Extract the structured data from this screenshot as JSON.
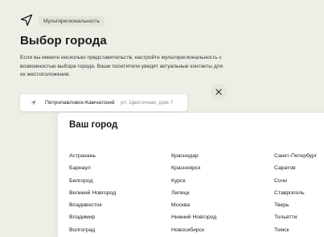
{
  "header": {
    "badge": "Мультирегиональность",
    "title": "Выбор города",
    "description": "Если вы имеете несколько представительств, настройте мультирегиональность с возможностью выбора города. Ваши посетители увидят актуальные контакты для их местоположения."
  },
  "selector": {
    "city": "Петропавловск-Камчатский",
    "address": "ул. Цвегочная, дом 7"
  },
  "modal": {
    "title": "Ваш город",
    "columns": [
      [
        "Астрахань",
        "Барнаул",
        "Белгород",
        "Великий Новгород",
        "Владивосток",
        "Владимир",
        "Волгоград"
      ],
      [
        "Краснодар",
        "Красноярск",
        "Курск",
        "Липецк",
        "Москва",
        "Нижний Новгород",
        "Новосибирск"
      ],
      [
        "Санкт-Петербург",
        "Саратов",
        "Сочи",
        "Ставрополь",
        "Тверь",
        "Тольятти",
        "Томск"
      ]
    ]
  },
  "icons": {
    "navigation": "navigation-arrow-icon",
    "pin": "location-pin-icon",
    "close": "close-icon"
  }
}
